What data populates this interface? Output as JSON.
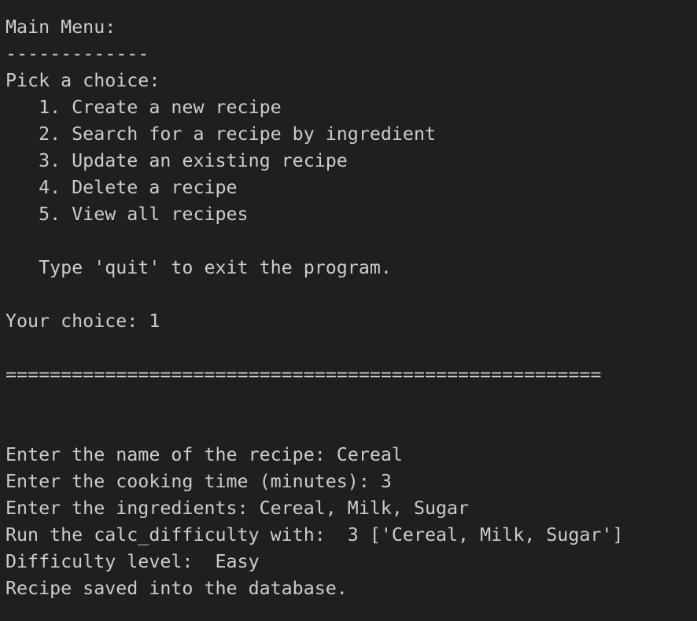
{
  "terminal": {
    "lines": [
      "Main Menu:",
      "-------------",
      "Pick a choice:",
      "   1. Create a new recipe",
      "   2. Search for a recipe by ingredient",
      "   3. Update an existing recipe",
      "   4. Delete a recipe",
      "   5. View all recipes",
      "",
      "   Type 'quit' to exit the program.",
      "",
      "Your choice: 1",
      "",
      "======================================================",
      "",
      "",
      "Enter the name of the recipe: Cereal",
      "Enter the cooking time (minutes): 3",
      "Enter the ingredients: Cereal, Milk, Sugar",
      "Run the calc_difficulty with:  3 ['Cereal, Milk, Sugar']",
      "Difficulty level:  Easy",
      "Recipe saved into the database."
    ]
  },
  "colors": {
    "background": "#1f1f1f",
    "text": "#c9ccd2"
  }
}
